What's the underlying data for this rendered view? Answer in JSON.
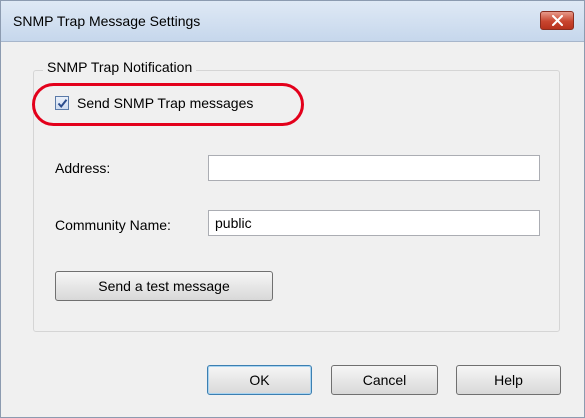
{
  "window": {
    "title": "SNMP Trap Message Settings"
  },
  "group": {
    "legend": "SNMP Trap Notification"
  },
  "send_trap": {
    "label": "Send SNMP Trap messages",
    "checked": true
  },
  "address": {
    "label": "Address:",
    "value": ""
  },
  "community": {
    "label": "Community Name:",
    "value": "public"
  },
  "buttons": {
    "test_message": "Send a test message",
    "ok": "OK",
    "cancel": "Cancel",
    "help": "Help"
  },
  "icons": {
    "close": "close-icon",
    "checkmark": "checkmark-icon"
  },
  "colors": {
    "highlight_ring": "#e3001b",
    "close_button": "#c8452f"
  }
}
